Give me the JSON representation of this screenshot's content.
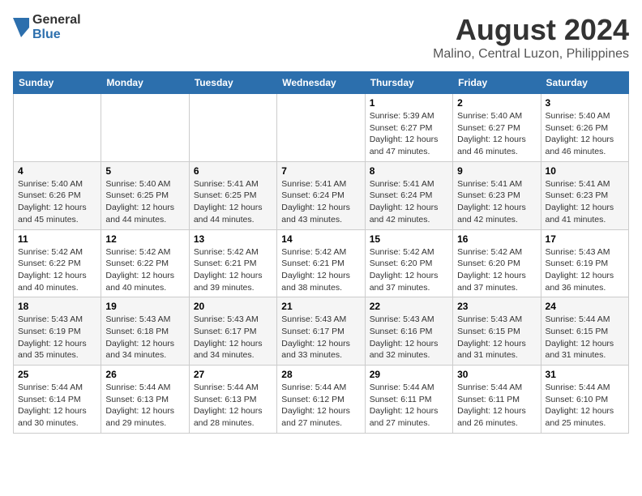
{
  "logo": {
    "general": "General",
    "blue": "Blue"
  },
  "title": "August 2024",
  "location": "Malino, Central Luzon, Philippines",
  "days_of_week": [
    "Sunday",
    "Monday",
    "Tuesday",
    "Wednesday",
    "Thursday",
    "Friday",
    "Saturday"
  ],
  "weeks": [
    [
      {
        "day": "",
        "info": ""
      },
      {
        "day": "",
        "info": ""
      },
      {
        "day": "",
        "info": ""
      },
      {
        "day": "",
        "info": ""
      },
      {
        "day": "1",
        "info": "Sunrise: 5:39 AM\nSunset: 6:27 PM\nDaylight: 12 hours\nand 47 minutes."
      },
      {
        "day": "2",
        "info": "Sunrise: 5:40 AM\nSunset: 6:27 PM\nDaylight: 12 hours\nand 46 minutes."
      },
      {
        "day": "3",
        "info": "Sunrise: 5:40 AM\nSunset: 6:26 PM\nDaylight: 12 hours\nand 46 minutes."
      }
    ],
    [
      {
        "day": "4",
        "info": "Sunrise: 5:40 AM\nSunset: 6:26 PM\nDaylight: 12 hours\nand 45 minutes."
      },
      {
        "day": "5",
        "info": "Sunrise: 5:40 AM\nSunset: 6:25 PM\nDaylight: 12 hours\nand 44 minutes."
      },
      {
        "day": "6",
        "info": "Sunrise: 5:41 AM\nSunset: 6:25 PM\nDaylight: 12 hours\nand 44 minutes."
      },
      {
        "day": "7",
        "info": "Sunrise: 5:41 AM\nSunset: 6:24 PM\nDaylight: 12 hours\nand 43 minutes."
      },
      {
        "day": "8",
        "info": "Sunrise: 5:41 AM\nSunset: 6:24 PM\nDaylight: 12 hours\nand 42 minutes."
      },
      {
        "day": "9",
        "info": "Sunrise: 5:41 AM\nSunset: 6:23 PM\nDaylight: 12 hours\nand 42 minutes."
      },
      {
        "day": "10",
        "info": "Sunrise: 5:41 AM\nSunset: 6:23 PM\nDaylight: 12 hours\nand 41 minutes."
      }
    ],
    [
      {
        "day": "11",
        "info": "Sunrise: 5:42 AM\nSunset: 6:22 PM\nDaylight: 12 hours\nand 40 minutes."
      },
      {
        "day": "12",
        "info": "Sunrise: 5:42 AM\nSunset: 6:22 PM\nDaylight: 12 hours\nand 40 minutes."
      },
      {
        "day": "13",
        "info": "Sunrise: 5:42 AM\nSunset: 6:21 PM\nDaylight: 12 hours\nand 39 minutes."
      },
      {
        "day": "14",
        "info": "Sunrise: 5:42 AM\nSunset: 6:21 PM\nDaylight: 12 hours\nand 38 minutes."
      },
      {
        "day": "15",
        "info": "Sunrise: 5:42 AM\nSunset: 6:20 PM\nDaylight: 12 hours\nand 37 minutes."
      },
      {
        "day": "16",
        "info": "Sunrise: 5:42 AM\nSunset: 6:20 PM\nDaylight: 12 hours\nand 37 minutes."
      },
      {
        "day": "17",
        "info": "Sunrise: 5:43 AM\nSunset: 6:19 PM\nDaylight: 12 hours\nand 36 minutes."
      }
    ],
    [
      {
        "day": "18",
        "info": "Sunrise: 5:43 AM\nSunset: 6:19 PM\nDaylight: 12 hours\nand 35 minutes."
      },
      {
        "day": "19",
        "info": "Sunrise: 5:43 AM\nSunset: 6:18 PM\nDaylight: 12 hours\nand 34 minutes."
      },
      {
        "day": "20",
        "info": "Sunrise: 5:43 AM\nSunset: 6:17 PM\nDaylight: 12 hours\nand 34 minutes."
      },
      {
        "day": "21",
        "info": "Sunrise: 5:43 AM\nSunset: 6:17 PM\nDaylight: 12 hours\nand 33 minutes."
      },
      {
        "day": "22",
        "info": "Sunrise: 5:43 AM\nSunset: 6:16 PM\nDaylight: 12 hours\nand 32 minutes."
      },
      {
        "day": "23",
        "info": "Sunrise: 5:43 AM\nSunset: 6:15 PM\nDaylight: 12 hours\nand 31 minutes."
      },
      {
        "day": "24",
        "info": "Sunrise: 5:44 AM\nSunset: 6:15 PM\nDaylight: 12 hours\nand 31 minutes."
      }
    ],
    [
      {
        "day": "25",
        "info": "Sunrise: 5:44 AM\nSunset: 6:14 PM\nDaylight: 12 hours\nand 30 minutes."
      },
      {
        "day": "26",
        "info": "Sunrise: 5:44 AM\nSunset: 6:13 PM\nDaylight: 12 hours\nand 29 minutes."
      },
      {
        "day": "27",
        "info": "Sunrise: 5:44 AM\nSunset: 6:13 PM\nDaylight: 12 hours\nand 28 minutes."
      },
      {
        "day": "28",
        "info": "Sunrise: 5:44 AM\nSunset: 6:12 PM\nDaylight: 12 hours\nand 27 minutes."
      },
      {
        "day": "29",
        "info": "Sunrise: 5:44 AM\nSunset: 6:11 PM\nDaylight: 12 hours\nand 27 minutes."
      },
      {
        "day": "30",
        "info": "Sunrise: 5:44 AM\nSunset: 6:11 PM\nDaylight: 12 hours\nand 26 minutes."
      },
      {
        "day": "31",
        "info": "Sunrise: 5:44 AM\nSunset: 6:10 PM\nDaylight: 12 hours\nand 25 minutes."
      }
    ]
  ]
}
